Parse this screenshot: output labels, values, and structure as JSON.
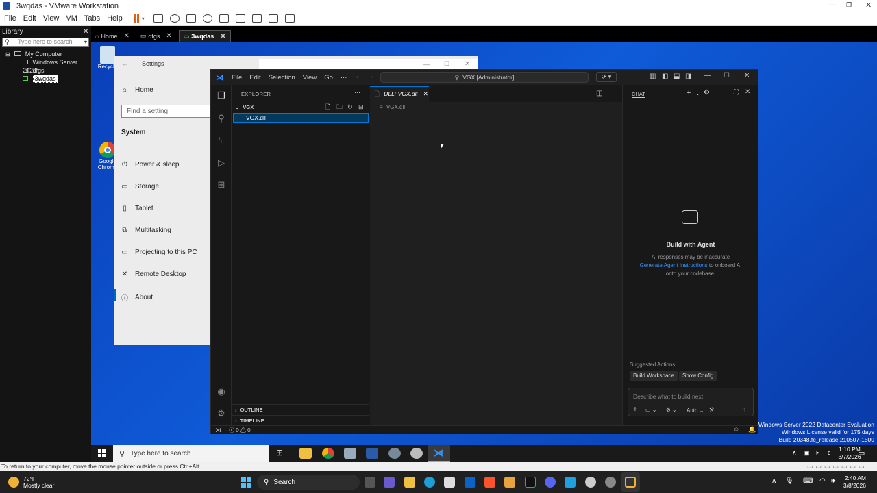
{
  "vmware": {
    "title": "3wqdas - VMware Workstation",
    "menu": [
      "File",
      "Edit",
      "View",
      "VM",
      "Tabs",
      "Help"
    ],
    "library": {
      "header": "Library",
      "search_placeholder": "Type here to search",
      "tree": [
        "My Computer",
        "Windows Server 2022",
        "dfgs",
        "3wqdas"
      ]
    },
    "tabs": [
      {
        "label": "Home"
      },
      {
        "label": "dfgs"
      },
      {
        "label": "3wqdas"
      }
    ],
    "status": "To return to your computer, move the mouse pointer outside or press Ctrl+Alt."
  },
  "desktop": {
    "icons": [
      "Recycle",
      "Google Chrome"
    ],
    "watermark": [
      "Windows Server 2022 Datacenter Evaluation",
      "Windows License valid for 175 days",
      "Build 20348.fe_release.210507-1500"
    ]
  },
  "settings": {
    "title": "Settings",
    "home": "Home",
    "search_placeholder": "Find a setting",
    "section": "System",
    "items": [
      "Power & sleep",
      "Storage",
      "Tablet",
      "Multitasking",
      "Projecting to this PC",
      "Remote Desktop",
      "About"
    ]
  },
  "vscode": {
    "menu": [
      "File",
      "Edit",
      "Selection",
      "View",
      "Go",
      "···"
    ],
    "search": "VGX [Administrator]",
    "explorer": {
      "header": "EXPLORER",
      "folder": "VGX",
      "file": "VGX.dll",
      "outline": "OUTLINE",
      "timeline": "TIMELINE"
    },
    "editor": {
      "tab": "DLL: VGX.dll",
      "breadcrumb": "VGX.dll"
    },
    "chat": {
      "header": "CHAT",
      "title": "Build with Agent",
      "line1": "AI responses may be inaccurate",
      "link": "Generate Agent Instructions",
      "line2": " to onboard AI",
      "line3": "onto your codebase.",
      "suggested": "Suggested Actions",
      "action1": "Build Workspace",
      "action2": "Show Config",
      "input_placeholder": "Describe what to build next",
      "mode": "Auto"
    },
    "status": {
      "errors": "0",
      "warnings": "0"
    }
  },
  "guest_taskbar": {
    "search_placeholder": "Type here to search",
    "time": "1:10 PM",
    "date": "3/7/2026"
  },
  "host_taskbar": {
    "weather_temp": "72°F",
    "weather_desc": "Mostly clear",
    "search": "Search",
    "time": "2:40 AM",
    "date": "3/8/2026"
  }
}
